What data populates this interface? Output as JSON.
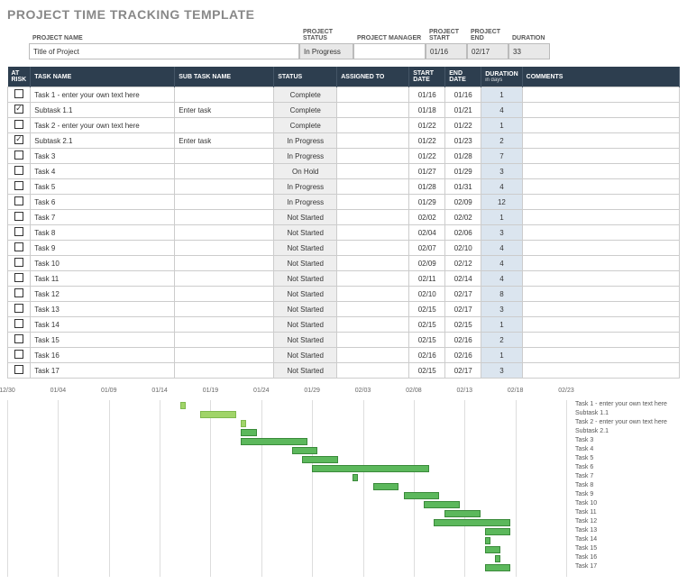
{
  "title": "PROJECT TIME TRACKING TEMPLATE",
  "meta": {
    "project_name_label": "PROJECT NAME",
    "project_name_value": "Title of Project",
    "project_status_label": "PROJECT STATUS",
    "project_status_value": "In Progress",
    "project_manager_label": "PROJECT MANAGER",
    "project_manager_value": "",
    "project_start_label": "PROJECT START",
    "project_start_value": "01/16",
    "project_end_label": "PROJECT END",
    "project_end_value": "02/17",
    "duration_label": "DURATION",
    "duration_sub": "in days",
    "duration_value": "33"
  },
  "headers": {
    "at_risk": "AT RISK",
    "task": "TASK NAME",
    "sub": "SUB TASK NAME",
    "status": "STATUS",
    "assigned": "ASSIGNED TO",
    "start": "START DATE",
    "end": "END DATE",
    "duration": "DURATION",
    "duration_sub": "in days",
    "comments": "COMMENTS"
  },
  "tasks": [
    {
      "risk": false,
      "name": "Task 1 - enter your own text here",
      "sub": "",
      "status": "Complete",
      "assigned": "",
      "start": "01/16",
      "end": "01/16",
      "dur": "1",
      "comments": ""
    },
    {
      "risk": true,
      "name": "Subtask 1.1",
      "sub": "Enter task",
      "status": "Complete",
      "assigned": "",
      "start": "01/18",
      "end": "01/21",
      "dur": "4",
      "comments": ""
    },
    {
      "risk": false,
      "name": "Task 2 - enter your own text here",
      "sub": "",
      "status": "Complete",
      "assigned": "",
      "start": "01/22",
      "end": "01/22",
      "dur": "1",
      "comments": ""
    },
    {
      "risk": true,
      "name": "Subtask 2.1",
      "sub": "Enter task",
      "status": "In Progress",
      "assigned": "",
      "start": "01/22",
      "end": "01/23",
      "dur": "2",
      "comments": ""
    },
    {
      "risk": false,
      "name": "Task 3",
      "sub": "",
      "status": "In Progress",
      "assigned": "",
      "start": "01/22",
      "end": "01/28",
      "dur": "7",
      "comments": ""
    },
    {
      "risk": false,
      "name": "Task 4",
      "sub": "",
      "status": "On Hold",
      "assigned": "",
      "start": "01/27",
      "end": "01/29",
      "dur": "3",
      "comments": ""
    },
    {
      "risk": false,
      "name": "Task 5",
      "sub": "",
      "status": "In Progress",
      "assigned": "",
      "start": "01/28",
      "end": "01/31",
      "dur": "4",
      "comments": ""
    },
    {
      "risk": false,
      "name": "Task 6",
      "sub": "",
      "status": "In Progress",
      "assigned": "",
      "start": "01/29",
      "end": "02/09",
      "dur": "12",
      "comments": ""
    },
    {
      "risk": false,
      "name": "Task 7",
      "sub": "",
      "status": "Not Started",
      "assigned": "",
      "start": "02/02",
      "end": "02/02",
      "dur": "1",
      "comments": ""
    },
    {
      "risk": false,
      "name": "Task 8",
      "sub": "",
      "status": "Not Started",
      "assigned": "",
      "start": "02/04",
      "end": "02/06",
      "dur": "3",
      "comments": ""
    },
    {
      "risk": false,
      "name": "Task 9",
      "sub": "",
      "status": "Not Started",
      "assigned": "",
      "start": "02/07",
      "end": "02/10",
      "dur": "4",
      "comments": ""
    },
    {
      "risk": false,
      "name": "Task 10",
      "sub": "",
      "status": "Not Started",
      "assigned": "",
      "start": "02/09",
      "end": "02/12",
      "dur": "4",
      "comments": ""
    },
    {
      "risk": false,
      "name": "Task 11",
      "sub": "",
      "status": "Not Started",
      "assigned": "",
      "start": "02/11",
      "end": "02/14",
      "dur": "4",
      "comments": ""
    },
    {
      "risk": false,
      "name": "Task 12",
      "sub": "",
      "status": "Not Started",
      "assigned": "",
      "start": "02/10",
      "end": "02/17",
      "dur": "8",
      "comments": ""
    },
    {
      "risk": false,
      "name": "Task 13",
      "sub": "",
      "status": "Not Started",
      "assigned": "",
      "start": "02/15",
      "end": "02/17",
      "dur": "3",
      "comments": ""
    },
    {
      "risk": false,
      "name": "Task 14",
      "sub": "",
      "status": "Not Started",
      "assigned": "",
      "start": "02/15",
      "end": "02/15",
      "dur": "1",
      "comments": ""
    },
    {
      "risk": false,
      "name": "Task 15",
      "sub": "",
      "status": "Not Started",
      "assigned": "",
      "start": "02/15",
      "end": "02/16",
      "dur": "2",
      "comments": ""
    },
    {
      "risk": false,
      "name": "Task 16",
      "sub": "",
      "status": "Not Started",
      "assigned": "",
      "start": "02/16",
      "end": "02/16",
      "dur": "1",
      "comments": ""
    },
    {
      "risk": false,
      "name": "Task 17",
      "sub": "",
      "status": "Not Started",
      "assigned": "",
      "start": "02/15",
      "end": "02/17",
      "dur": "3",
      "comments": ""
    }
  ],
  "chart_data": {
    "type": "bar",
    "title": "",
    "xlabel": "",
    "ylabel": "",
    "x_ticks": [
      "12/30",
      "01/04",
      "01/09",
      "01/14",
      "01/19",
      "01/24",
      "01/29",
      "02/03",
      "02/08",
      "02/13",
      "02/18",
      "02/23"
    ],
    "x_range": [
      "12/30",
      "02/23"
    ],
    "series": [
      {
        "name": "Task 1 - enter your own text here",
        "start": "01/16",
        "end": "01/16",
        "light": true
      },
      {
        "name": "Subtask 1.1",
        "start": "01/18",
        "end": "01/21",
        "light": true
      },
      {
        "name": "Task 2 - enter your own text here",
        "start": "01/22",
        "end": "01/22",
        "light": true
      },
      {
        "name": "Subtask 2.1",
        "start": "01/22",
        "end": "01/23",
        "light": false
      },
      {
        "name": "Task 3",
        "start": "01/22",
        "end": "01/28",
        "light": false
      },
      {
        "name": "Task 4",
        "start": "01/27",
        "end": "01/29",
        "light": false
      },
      {
        "name": "Task 5",
        "start": "01/28",
        "end": "01/31",
        "light": false
      },
      {
        "name": "Task 6",
        "start": "01/29",
        "end": "02/09",
        "light": false
      },
      {
        "name": "Task 7",
        "start": "02/02",
        "end": "02/02",
        "light": false
      },
      {
        "name": "Task 8",
        "start": "02/04",
        "end": "02/06",
        "light": false
      },
      {
        "name": "Task 9",
        "start": "02/07",
        "end": "02/10",
        "light": false
      },
      {
        "name": "Task 10",
        "start": "02/09",
        "end": "02/12",
        "light": false
      },
      {
        "name": "Task 11",
        "start": "02/11",
        "end": "02/14",
        "light": false
      },
      {
        "name": "Task 12",
        "start": "02/10",
        "end": "02/17",
        "light": false
      },
      {
        "name": "Task 13",
        "start": "02/15",
        "end": "02/17",
        "light": false
      },
      {
        "name": "Task 14",
        "start": "02/15",
        "end": "02/15",
        "light": false
      },
      {
        "name": "Task 15",
        "start": "02/15",
        "end": "02/16",
        "light": false
      },
      {
        "name": "Task 16",
        "start": "02/16",
        "end": "02/16",
        "light": false
      },
      {
        "name": "Task 17",
        "start": "02/15",
        "end": "02/17",
        "light": false
      }
    ]
  }
}
